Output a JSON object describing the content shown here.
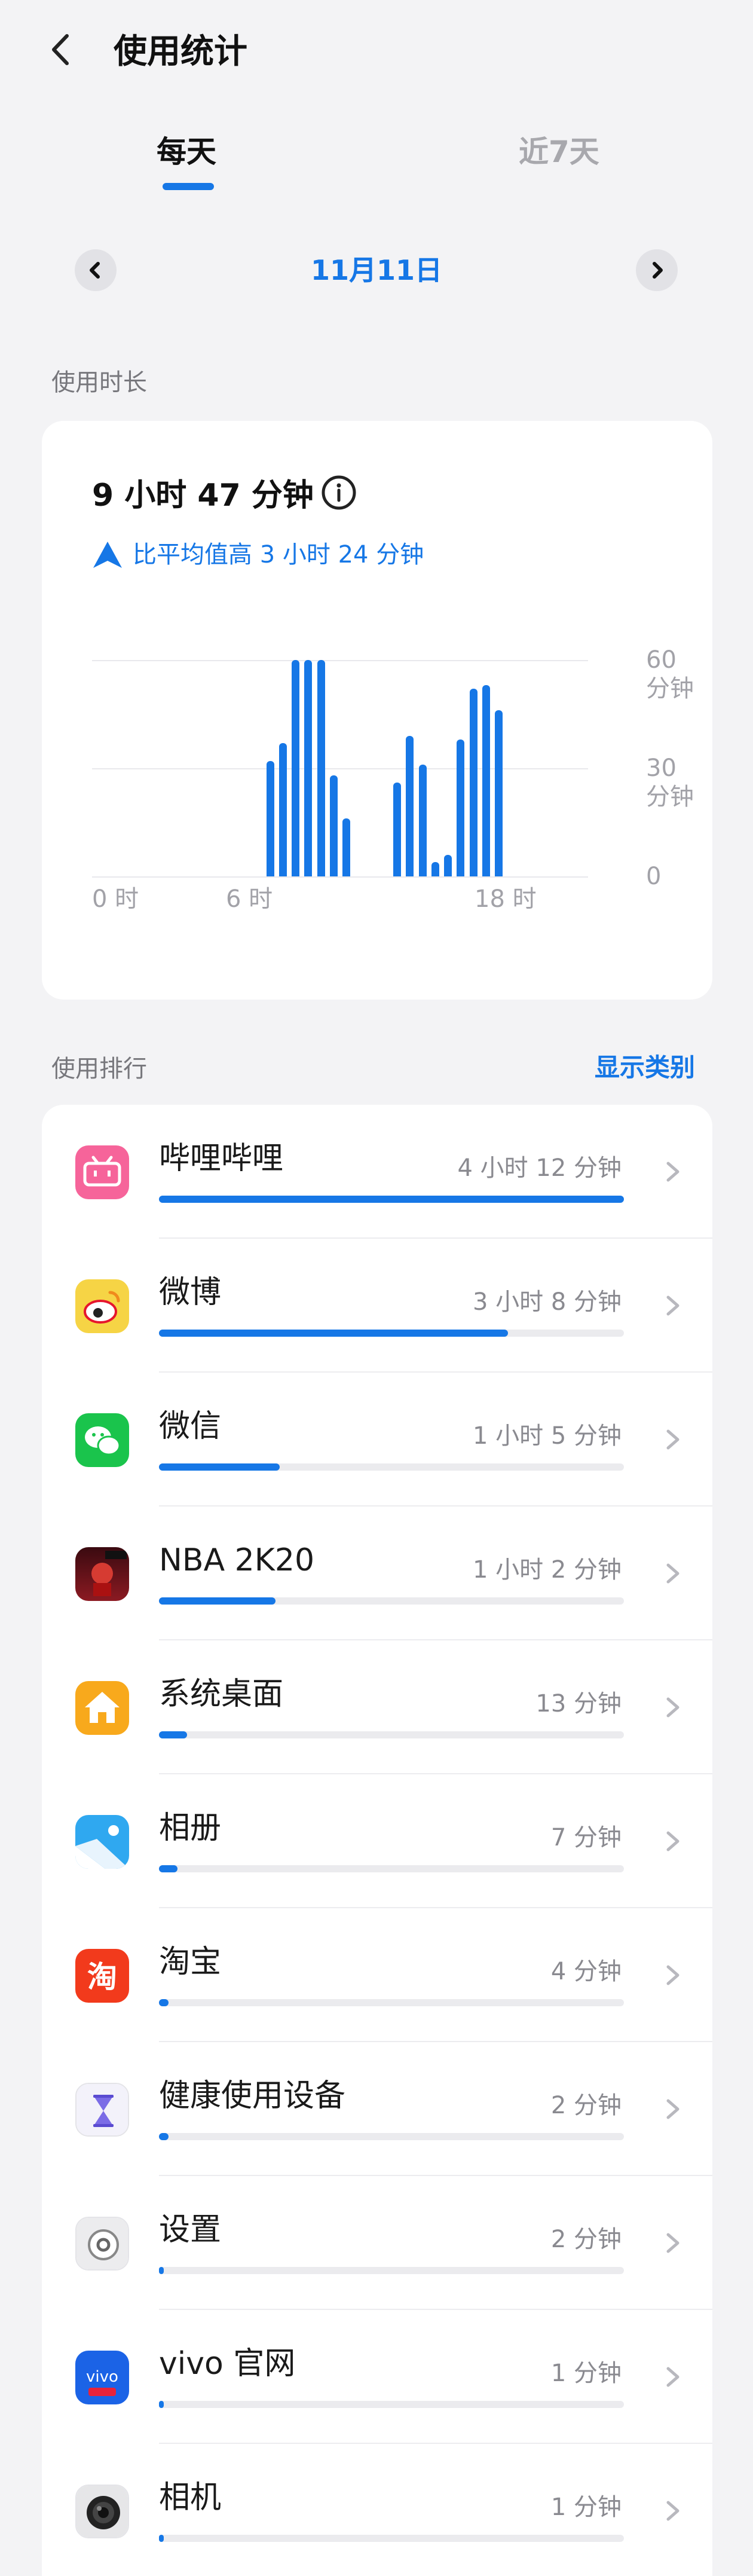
{
  "header": {
    "title": "使用统计"
  },
  "tabs": [
    {
      "label": "每天",
      "active": true
    },
    {
      "label": "近7天",
      "active": false
    }
  ],
  "date_nav": {
    "date": "11月11日"
  },
  "usage": {
    "section_label": "使用时长",
    "total": "9 小时 47 分钟",
    "compare": "比平均值高 3 小时 24 分钟"
  },
  "chart_data": {
    "type": "bar",
    "unit": "分钟",
    "x": [
      7.0,
      7.5,
      8.0,
      8.5,
      9.0,
      9.5,
      10.0,
      10.5,
      12.0,
      12.5,
      13.0,
      13.5,
      14.0,
      14.5,
      15.0,
      15.5,
      16.0,
      16.5
    ],
    "values": [
      32,
      37,
      60,
      60,
      60,
      28,
      16,
      0,
      26,
      39,
      31,
      4,
      6,
      38,
      52,
      53,
      46,
      0
    ],
    "ylim": [
      0,
      60
    ],
    "y_ticks": [
      "60 分钟",
      "30 分钟",
      "0"
    ],
    "x_ticks": [
      "0 时",
      "6 时",
      "",
      "18 时"
    ],
    "grid": true
  },
  "ranking": {
    "section_label": "使用排行",
    "show_category": "显示类别",
    "apps": [
      {
        "name": "哔哩哔哩",
        "time": "4 小时 12 分钟",
        "fraction": 1.0,
        "icon": "bilibili-icon",
        "color": "#f6649a"
      },
      {
        "name": "微博",
        "time": "3 小时 8 分钟",
        "fraction": 0.75,
        "icon": "weibo-icon",
        "color": "#f6d445"
      },
      {
        "name": "微信",
        "time": "1 小时 5 分钟",
        "fraction": 0.26,
        "icon": "wechat-icon",
        "color": "#1ac44c"
      },
      {
        "name": "NBA 2K20",
        "time": "1 小时 2 分钟",
        "fraction": 0.25,
        "icon": "nba2k20-icon",
        "color": "#8c1a22"
      },
      {
        "name": "系统桌面",
        "time": "13 分钟",
        "fraction": 0.06,
        "icon": "home-icon",
        "color": "#f8a91c"
      },
      {
        "name": "相册",
        "time": "7 分钟",
        "fraction": 0.04,
        "icon": "gallery-icon",
        "color": "#2fa8f0"
      },
      {
        "name": "淘宝",
        "time": "4 分钟",
        "fraction": 0.02,
        "icon": "taobao-icon",
        "color": "#f23a1c"
      },
      {
        "name": "健康使用设备",
        "time": "2 分钟",
        "fraction": 0.02,
        "icon": "hourglass-icon",
        "color": "#f3f2fa"
      },
      {
        "name": "设置",
        "time": "2 分钟",
        "fraction": 0.01,
        "icon": "settings-icon",
        "color": "#ececee"
      },
      {
        "name": "vivo 官网",
        "time": "1 分钟",
        "fraction": 0.01,
        "icon": "vivo-icon",
        "color": "#1b63e6"
      },
      {
        "name": "相机",
        "time": "1 分钟",
        "fraction": 0.01,
        "icon": "camera-icon",
        "color": "#e6e6e8"
      }
    ]
  }
}
